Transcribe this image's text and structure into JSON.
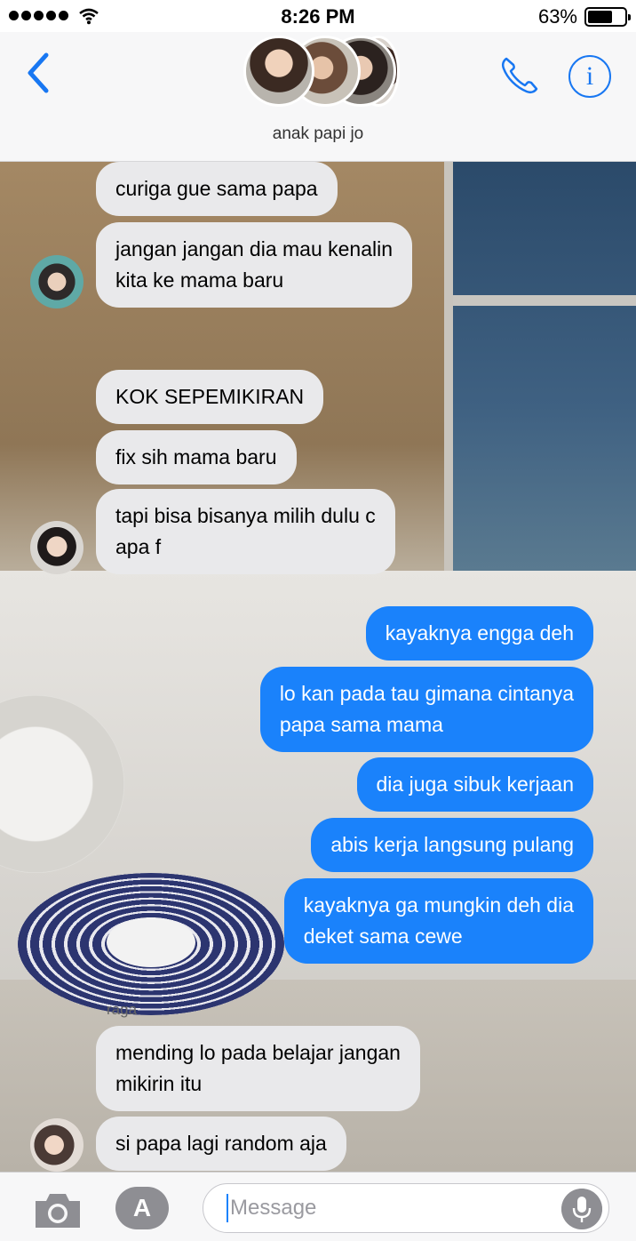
{
  "status_bar": {
    "time": "8:26 PM",
    "battery_percent": "63%",
    "battery_level": 0.63,
    "signal_bars": 5
  },
  "header": {
    "group_name": "anak papi jo",
    "icons": [
      "chevron-left-icon",
      "phone-icon",
      "info-icon"
    ],
    "info_glyph": "i"
  },
  "messages": [
    {
      "dir": "in",
      "text_lines": [
        "curiga gue sama papa"
      ]
    },
    {
      "dir": "in",
      "text_lines": [
        "jangan jangan dia mau kenalin",
        "kita ke mama baru"
      ]
    },
    {
      "dir": "in",
      "text_lines": [
        "KOK SEPEMIKIRAN"
      ]
    },
    {
      "dir": "in",
      "text_lines": [
        "fix sih mama baru"
      ]
    },
    {
      "dir": "in",
      "text_lines": [
        "tapi bisa bisanya milih dulu c",
        "apa f"
      ]
    },
    {
      "dir": "out",
      "text_lines": [
        "kayaknya engga deh"
      ]
    },
    {
      "dir": "out",
      "text_lines": [
        "lo kan pada tau gimana cintanya",
        "papa sama mama"
      ]
    },
    {
      "dir": "out",
      "text_lines": [
        "dia juga sibuk kerjaan"
      ]
    },
    {
      "dir": "out",
      "text_lines": [
        "abis kerja langsung pulang"
      ]
    },
    {
      "dir": "out",
      "text_lines": [
        "kayaknya ga mungkin deh dia",
        "deket sama cewe"
      ]
    },
    {
      "dir": "in",
      "sender": "raga",
      "text_lines": [
        "mending lo pada belajar jangan",
        "mikirin itu"
      ]
    },
    {
      "dir": "in",
      "text_lines": [
        "si papa lagi random aja"
      ]
    }
  ],
  "input_bar": {
    "placeholder": "Message",
    "apps_glyph": "A",
    "icons": [
      "camera-icon",
      "app-store-icon",
      "microphone-icon"
    ]
  },
  "colors": {
    "accent": "#1877f2",
    "outgoing_bubble": "#1a82fb",
    "incoming_bubble": "#e9e9eb"
  }
}
